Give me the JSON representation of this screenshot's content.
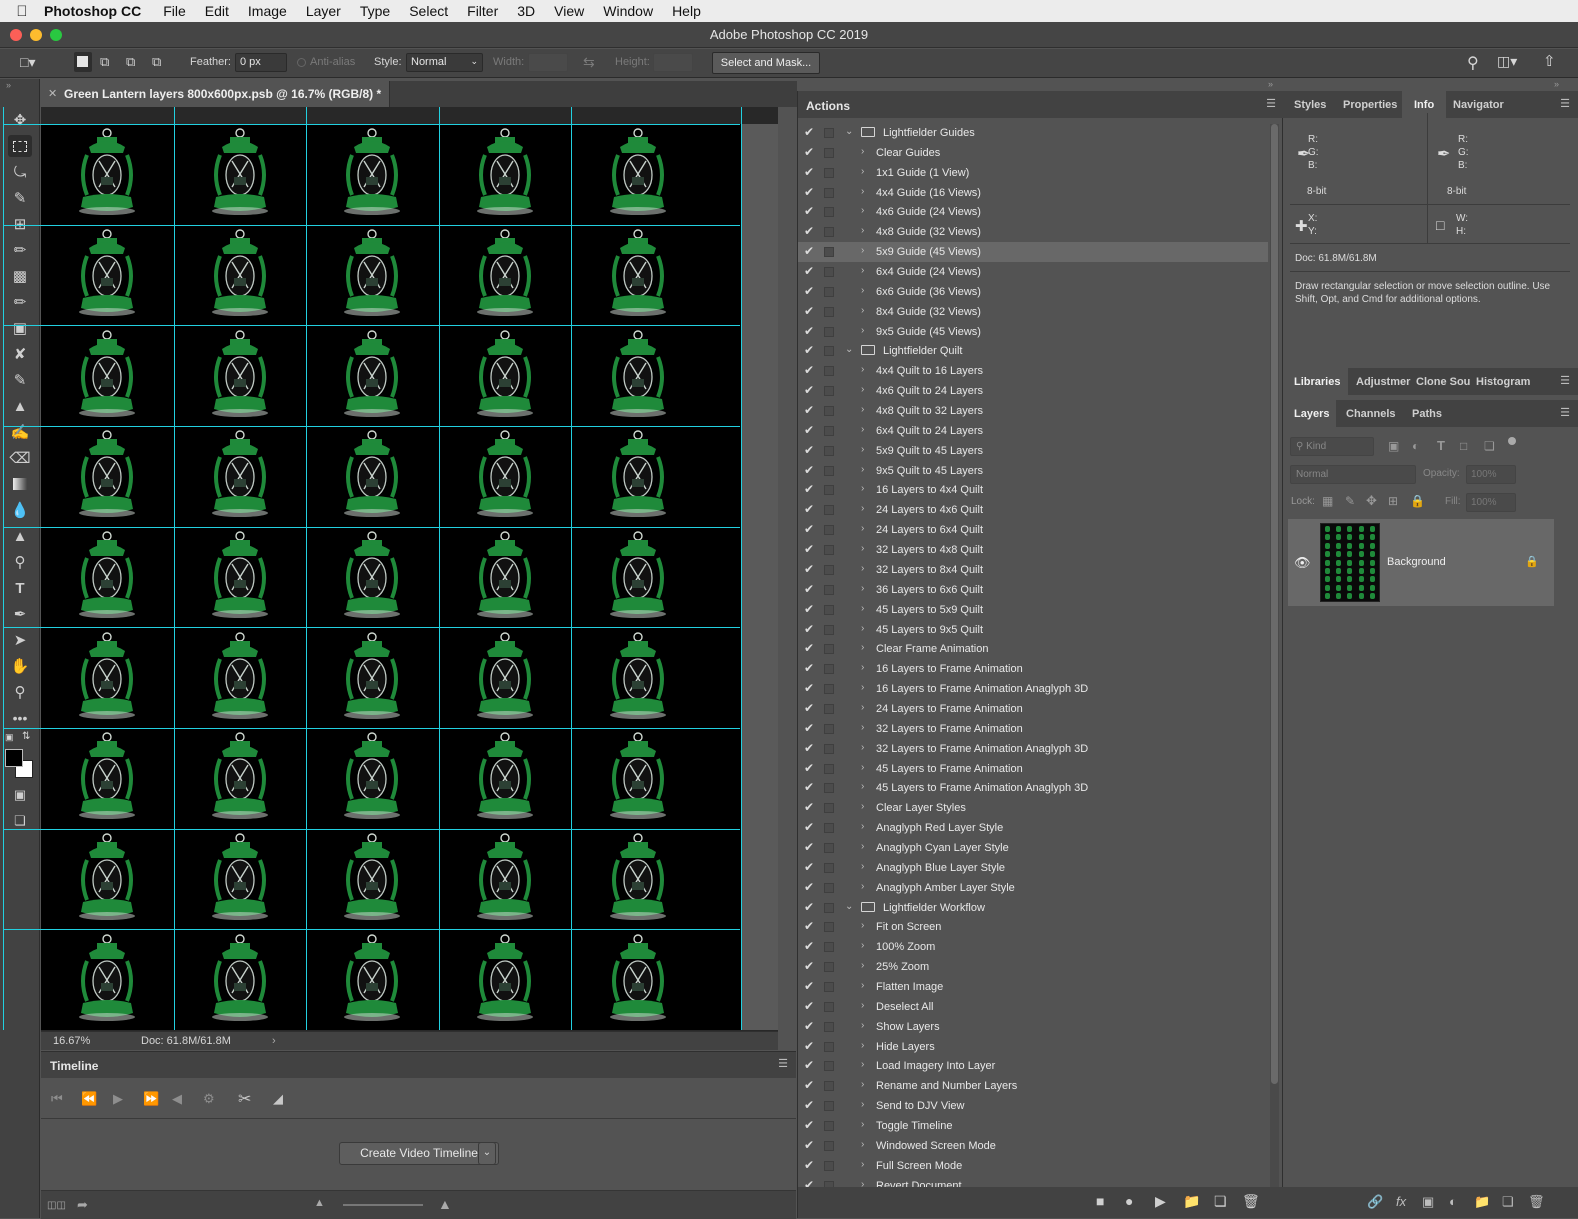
{
  "menubar": {
    "apple": "",
    "app": "Photoshop CC",
    "items": [
      "File",
      "Edit",
      "Image",
      "Layer",
      "Type",
      "Select",
      "Filter",
      "3D",
      "View",
      "Window",
      "Help"
    ]
  },
  "window": {
    "title": "Adobe Photoshop CC 2019"
  },
  "options": {
    "feather_label": "Feather:",
    "feather_value": "0 px",
    "antialias": "Anti-alias",
    "style_label": "Style:",
    "style_value": "Normal",
    "width_label": "Width:",
    "height_label": "Height:",
    "select_mask": "Select and Mask..."
  },
  "document": {
    "tab": "Green Lantern layers 800x600px.psb @ 16.7% (RGB/8) *",
    "zoom": "16.67%",
    "doc_size": "Doc: 61.8M/61.8M",
    "grid_cols": 5,
    "grid_rows": 9,
    "guide_color": "#22d0e0",
    "lantern_color": "#1f8a3a"
  },
  "timeline": {
    "title": "Timeline",
    "create_button": "Create Video Timeline"
  },
  "actions": {
    "title": "Actions",
    "rows": [
      {
        "label": "Lightfielder Guides",
        "set": true
      },
      {
        "label": "Clear Guides"
      },
      {
        "label": "1x1 Guide (1 View)"
      },
      {
        "label": "4x4 Guide (16 Views)"
      },
      {
        "label": "4x6 Guide (24 Views)"
      },
      {
        "label": "4x8 Guide (32 Views)"
      },
      {
        "label": "5x9 Guide (45 Views)",
        "hl": true
      },
      {
        "label": "6x4 Guide (24 Views)"
      },
      {
        "label": "6x6 Guide (36 Views)"
      },
      {
        "label": "8x4 Guide (32 Views)"
      },
      {
        "label": "9x5 Guide (45 Views)"
      },
      {
        "label": "Lightfielder Quilt",
        "set": true
      },
      {
        "label": "4x4 Quilt to 16 Layers"
      },
      {
        "label": "4x6 Quilt to 24 Layers"
      },
      {
        "label": "4x8 Quilt to 32 Layers"
      },
      {
        "label": "6x4 Quilt to 24 Layers"
      },
      {
        "label": "5x9 Quilt to 45 Layers"
      },
      {
        "label": "9x5 Quilt to 45 Layers"
      },
      {
        "label": "16 Layers to 4x4 Quilt"
      },
      {
        "label": "24 Layers to 4x6 Quilt"
      },
      {
        "label": "24 Layers to 6x4 Quilt"
      },
      {
        "label": "32 Layers to 4x8 Quilt"
      },
      {
        "label": "32 Layers to 8x4 Quilt"
      },
      {
        "label": "36 Layers to 6x6 Quilt"
      },
      {
        "label": "45 Layers to 5x9 Quilt"
      },
      {
        "label": "45 Layers to 9x5 Quilt"
      },
      {
        "label": "Clear Frame Animation"
      },
      {
        "label": "16 Layers to Frame Animation"
      },
      {
        "label": "16 Layers to Frame Animation Anaglyph 3D"
      },
      {
        "label": "24 Layers to Frame Animation"
      },
      {
        "label": "32 Layers to Frame Animation"
      },
      {
        "label": "32 Layers to Frame Animation Anaglyph 3D"
      },
      {
        "label": "45 Layers to Frame Animation"
      },
      {
        "label": "45 Layers to Frame Animation Anaglyph 3D"
      },
      {
        "label": "Clear Layer Styles"
      },
      {
        "label": "Anaglyph Red Layer Style"
      },
      {
        "label": "Anaglyph Cyan Layer Style"
      },
      {
        "label": "Anaglyph Blue Layer Style"
      },
      {
        "label": "Anaglyph Amber Layer Style"
      },
      {
        "label": "Lightfielder Workflow",
        "set": true
      },
      {
        "label": "Fit on Screen"
      },
      {
        "label": "100% Zoom"
      },
      {
        "label": "25% Zoom"
      },
      {
        "label": "Flatten Image"
      },
      {
        "label": "Deselect All"
      },
      {
        "label": "Show Layers"
      },
      {
        "label": "Hide Layers"
      },
      {
        "label": "Load Imagery Into Layer"
      },
      {
        "label": "Rename and Number Layers"
      },
      {
        "label": "Send to DJV View"
      },
      {
        "label": "Toggle Timeline"
      },
      {
        "label": "Windowed Screen Mode"
      },
      {
        "label": "Full Screen Mode"
      },
      {
        "label": "Revert Document"
      }
    ]
  },
  "info_panel": {
    "tabs": [
      "Styles",
      "Properties",
      "Info",
      "Navigator"
    ],
    "r": "R:",
    "g": "G:",
    "b": "B:",
    "bit": "8-bit",
    "x": "X:",
    "y": "Y:",
    "w": "W:",
    "h": "H:",
    "doc": "Doc: 61.8M/61.8M",
    "hint": "Draw rectangular selection or move selection outline. Use Shift, Opt, and Cmd for additional options."
  },
  "lib_panel": {
    "tabs": [
      "Libraries",
      "Adjustmer",
      "Clone Sou",
      "Histogram"
    ]
  },
  "layers_panel": {
    "tabs": [
      "Layers",
      "Channels",
      "Paths"
    ],
    "kind": "Kind",
    "blend": "Normal",
    "opacity_label": "Opacity:",
    "opacity_value": "100%",
    "lock_label": "Lock:",
    "fill_label": "Fill:",
    "fill_value": "100%",
    "layer_name": "Background"
  }
}
